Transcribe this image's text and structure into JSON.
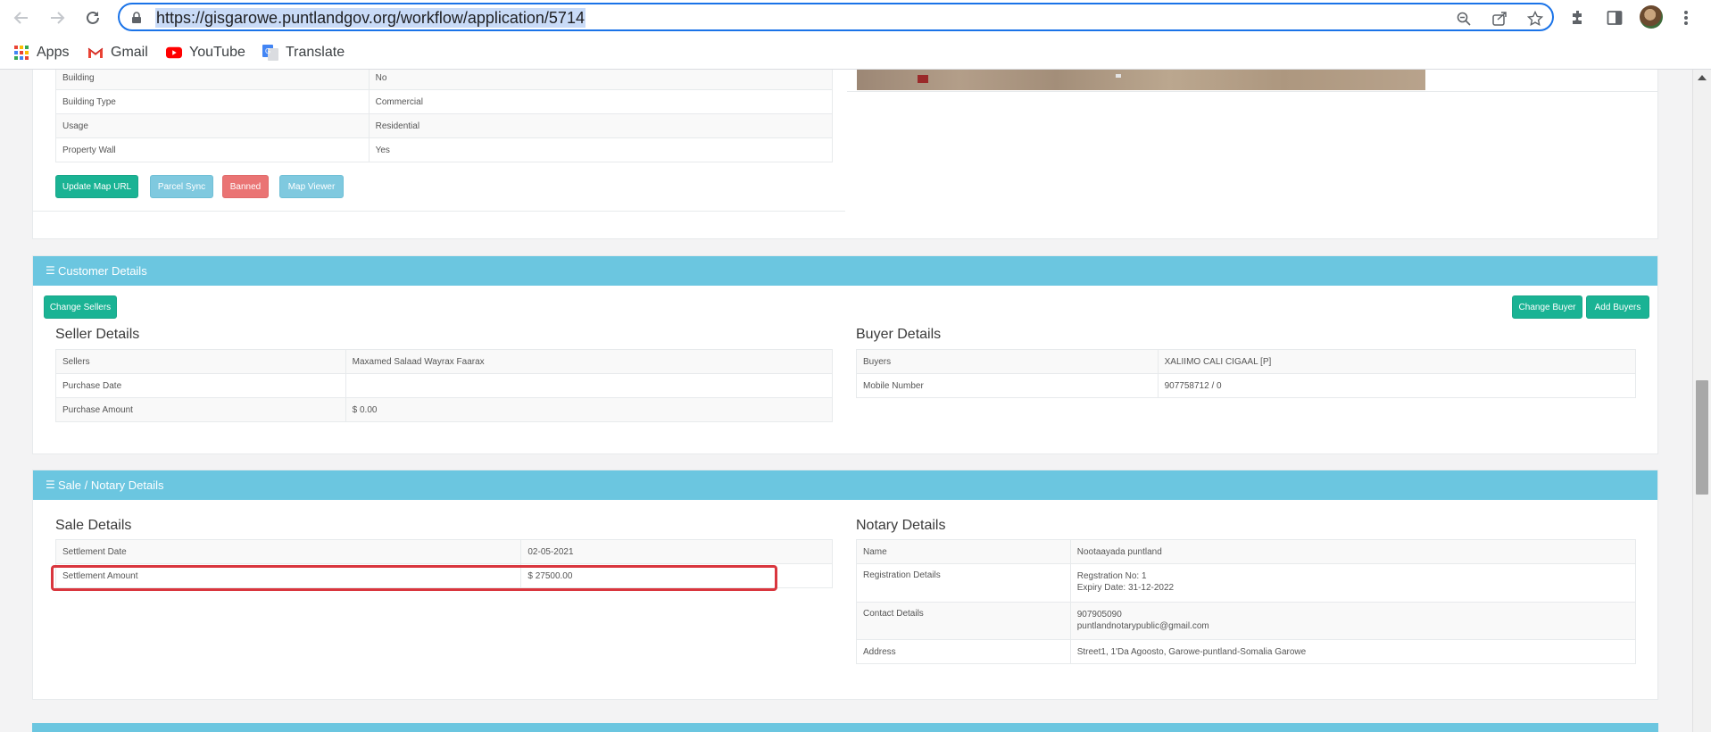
{
  "browser": {
    "url": "https://gisgarowe.puntlandgov.org/workflow/application/5714",
    "bookmarks": [
      "Apps",
      "Gmail",
      "YouTube",
      "Translate"
    ],
    "icons": [
      "back-arrow-icon",
      "forward-arrow-icon",
      "reload-icon",
      "lock-icon",
      "zoom-icon",
      "share-icon",
      "star-icon",
      "extensions-icon",
      "side-panel-icon",
      "menu-icon"
    ]
  },
  "property": {
    "rows": [
      {
        "label": "Building",
        "value": "No"
      },
      {
        "label": "Building Type",
        "value": "Commercial"
      },
      {
        "label": "Usage",
        "value": "Residential"
      },
      {
        "label": "Property Wall",
        "value": "Yes"
      }
    ],
    "buttons": {
      "update_map": "Update Map URL",
      "parcel_sync": "Parcel Sync",
      "banned": "Banned",
      "map_viewer": "Map Viewer"
    }
  },
  "customer": {
    "title": "Customer Details",
    "change_sellers": "Change Sellers",
    "change_buyer": "Change Buyer",
    "add_buyers": "Add Buyers",
    "seller_title": "Seller Details",
    "seller_rows": [
      {
        "label": "Sellers",
        "value": "Maxamed Salaad Wayrax Faarax"
      },
      {
        "label": "Purchase Date",
        "value": ""
      },
      {
        "label": "Purchase Amount",
        "value": "$ 0.00"
      }
    ],
    "buyer_title": "Buyer Details",
    "buyer_rows": [
      {
        "label": "Buyers",
        "value": "XALIIMO CALI CIGAAL [P]"
      },
      {
        "label": "Mobile Number",
        "value": "907758712 / 0"
      }
    ]
  },
  "sale": {
    "title": "Sale / Notary Details",
    "sale_title": "Sale Details",
    "sale_rows": [
      {
        "label": "Settlement Date",
        "value": "02-05-2021"
      },
      {
        "label": "Settlement Amount",
        "value": "$ 27500.00"
      }
    ],
    "notary_title": "Notary Details",
    "notary": {
      "name_label": "Name",
      "name_value": "Nootaayada puntland",
      "reg_label": "Registration Details",
      "reg_line1": "Regstration No: 1",
      "reg_line2": "Expiry Date: 31-12-2022",
      "contact_label": "Contact Details",
      "contact_line1": "907905090",
      "contact_line2": "puntlandnotarypublic@gmail.com",
      "address_label": "Address",
      "address_value": "Street1, 1'Da Agoosto, Garowe-puntland-Somalia Garowe"
    }
  },
  "colors": {
    "panel_header": "#6bc6e0",
    "primary_button": "#1ab394",
    "info_button": "#7fc9df",
    "danger_button": "#ea7474",
    "highlight": "#d9363e"
  }
}
